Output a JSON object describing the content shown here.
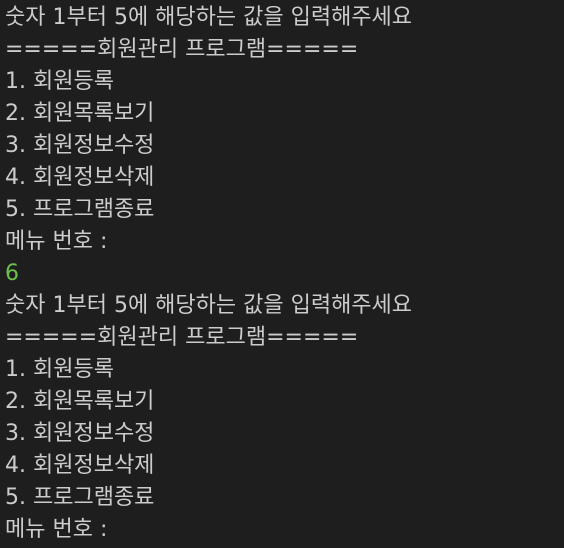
{
  "terminal": {
    "theme": {
      "background": "#1e1e1e",
      "text": "#cccccc",
      "user_input": "#6ec04b"
    },
    "lines": [
      "숫자 1부터 5에 해당하는 값을 입력해주세요",
      "=====회원관리 프로그램=====",
      "1. 회원등록",
      "2. 회원목록보기",
      "3. 회원정보수정",
      "4. 회원정보삭제",
      "5. 프로그램종료",
      "메뉴 번호 :",
      "6",
      "숫자 1부터 5에 해당하는 값을 입력해주세요",
      "=====회원관리 프로그램=====",
      "1. 회원등록",
      "2. 회원목록보기",
      "3. 회원정보수정",
      "4. 회원정보삭제",
      "5. 프로그램종료",
      "메뉴 번호 :"
    ]
  }
}
